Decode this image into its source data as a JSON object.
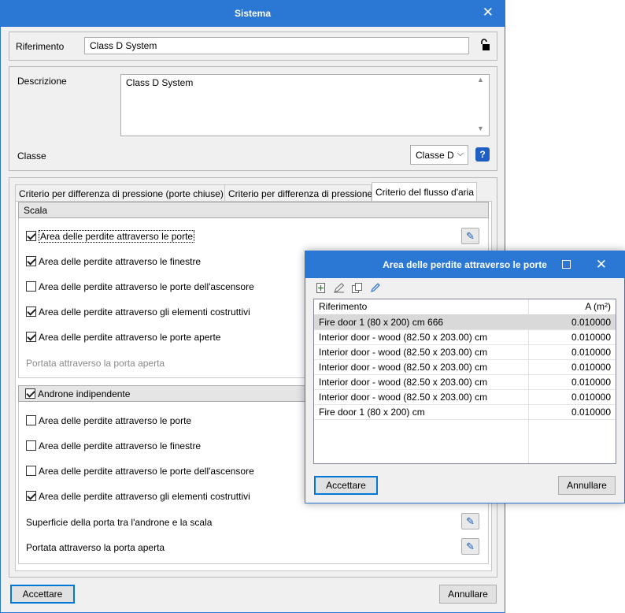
{
  "main": {
    "title": "Sistema",
    "riferimento_label": "Riferimento",
    "riferimento_value": "Class D System",
    "descrizione_label": "Descrizione",
    "descrizione_value": "Class D System",
    "classe_label": "Classe",
    "classe_value": "Classe D",
    "tabs": [
      {
        "label": "Criterio per differenza di pressione (porte chiuse)"
      },
      {
        "label": "Criterio per differenza di pressione"
      },
      {
        "label": "Criterio del flusso d'aria"
      }
    ],
    "scala": {
      "title": "Scala",
      "items": [
        {
          "label": "Area delle perdite attraverso le porte",
          "checked": true
        },
        {
          "label": "Area delle perdite attraverso le finestre",
          "checked": true
        },
        {
          "label": "Area delle perdite attraverso le porte dell'ascensore",
          "checked": false
        },
        {
          "label": "Area delle perdite attraverso gli elementi costruttivi",
          "checked": true
        },
        {
          "label": "Area delle perdite attraverso le porte aperte",
          "checked": true
        }
      ],
      "portata_label": "Portata attraverso la porta aperta"
    },
    "androne": {
      "title": "Androne indipendente",
      "checked": true,
      "items": [
        {
          "label": "Area delle perdite attraverso le porte",
          "checked": false
        },
        {
          "label": "Area delle perdite attraverso le finestre",
          "checked": false
        },
        {
          "label": "Area delle perdite attraverso le porte dell'ascensore",
          "checked": false
        },
        {
          "label": "Area delle perdite attraverso gli elementi costruttivi",
          "checked": true
        }
      ],
      "superficie_label": "Superficie della porta tra l'androne e la scala",
      "portata_label": "Portata attraverso la porta aperta"
    },
    "accept_label": "Accettare",
    "cancel_label": "Annullare"
  },
  "dialog": {
    "title": "Area delle perdite attraverso le porte",
    "columns": [
      "Riferimento",
      "A (m²)"
    ],
    "rows": [
      {
        "ref": "Fire door 1 (80 x 200) cm 666",
        "a": "0.010000"
      },
      {
        "ref": "Interior door - wood (82.50 x 203.00) cm",
        "a": "0.010000"
      },
      {
        "ref": "Interior door - wood (82.50 x 203.00) cm",
        "a": "0.010000"
      },
      {
        "ref": "Interior door - wood (82.50 x 203.00) cm",
        "a": "0.010000"
      },
      {
        "ref": "Interior door - wood (82.50 x 203.00) cm",
        "a": "0.010000"
      },
      {
        "ref": "Interior door - wood (82.50 x 203.00) cm",
        "a": "0.010000"
      },
      {
        "ref": "Fire door 1 (80 x 200) cm",
        "a": "0.010000"
      }
    ],
    "accept_label": "Accettare",
    "cancel_label": "Annullare"
  },
  "colors": {
    "titlebar": "#2b77d4",
    "selected_row": "#d9d9d9"
  }
}
